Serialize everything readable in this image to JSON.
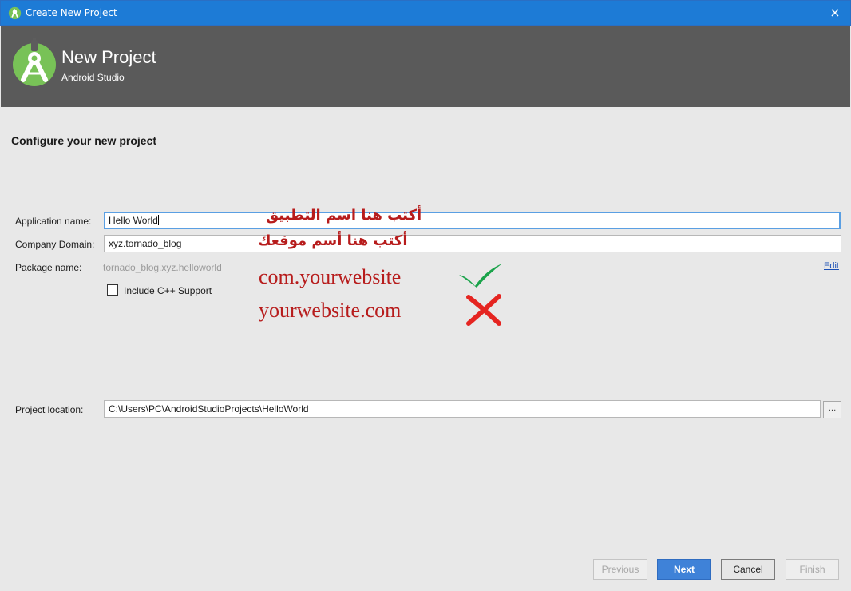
{
  "window": {
    "title": "Create New Project",
    "close_label": "×"
  },
  "banner": {
    "title": "New Project",
    "subtitle": "Android Studio"
  },
  "page": {
    "heading": "Configure your new project"
  },
  "form": {
    "application_name": {
      "label": "Application name:",
      "value": "Hello World"
    },
    "company_domain": {
      "label": "Company Domain:",
      "value": "xyz.tornado_blog"
    },
    "package_name": {
      "label": "Package name:",
      "value": "tornado_blog.xyz.helloworld",
      "edit_label": "Edit"
    },
    "cpp_support": {
      "label": "Include C++ Support",
      "checked": false
    },
    "project_location": {
      "label": "Project location:",
      "value": "C:\\Users\\PC\\AndroidStudioProjects\\HelloWorld",
      "browse_label": "..."
    }
  },
  "annotations": {
    "app_name_hint": "أكتب هنا اسم التطبيق",
    "domain_hint": "أكتب هنا أسم موقعك",
    "correct_example": "com.yourwebsite",
    "wrong_example": "yourwebsite.com",
    "correct_color": "#1aa34a",
    "wrong_color": "#e52521"
  },
  "buttons": {
    "previous": "Previous",
    "next": "Next",
    "cancel": "Cancel",
    "finish": "Finish"
  },
  "colors": {
    "titlebar": "#1d7bd6",
    "banner": "#5a5a5a",
    "primary_button": "#3f82d8",
    "annotation_text": "#b71c1c"
  }
}
